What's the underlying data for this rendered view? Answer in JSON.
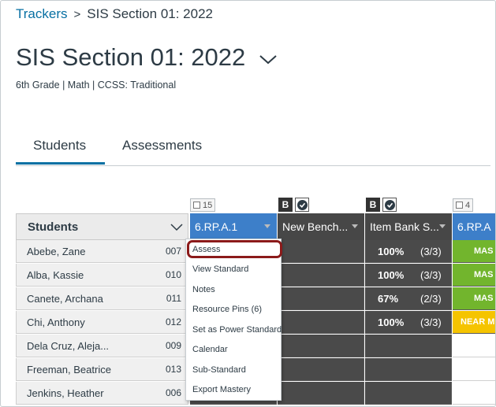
{
  "breadcrumb": {
    "link": "Trackers",
    "separator": ">",
    "current": "SIS Section 01: 2022"
  },
  "title": "SIS Section 01: 2022",
  "subtitle": "6th Grade | Math | CCSS: Traditional",
  "tabs": [
    {
      "label": "Students",
      "active": true
    },
    {
      "label": "Assessments",
      "active": false
    }
  ],
  "badges": {
    "col1": "15",
    "col2": "B",
    "col3": "B",
    "col4": "4"
  },
  "grid": {
    "students_header": "Students",
    "columns": [
      "6.RP.A.1",
      "New Bench...",
      "Item Bank S...",
      "6.RP.A"
    ],
    "rows": [
      {
        "name": "Abebe, Zane",
        "id": "007",
        "score": "",
        "fraction": "",
        "mastery": "MAS",
        "mastery_color": "green"
      },
      {
        "name": "Alba, Kassie",
        "id": "010",
        "score": "100%",
        "fraction": "(3/3)",
        "mastery": "MAS",
        "mastery_color": "green"
      },
      {
        "name": "Canete, Archana",
        "id": "011",
        "score": "67%",
        "fraction": "(2/3)",
        "mastery": "MAS",
        "mastery_color": "green"
      },
      {
        "name": "Chi, Anthony",
        "id": "012",
        "score": "100%",
        "fraction": "(3/3)",
        "mastery": "NEAR M",
        "mastery_color": "yellow"
      },
      {
        "name": "Dela Cruz, Aleja...",
        "id": "009",
        "score": "",
        "fraction": "",
        "mastery": "",
        "mastery_color": "empty"
      },
      {
        "name": "Freeman, Beatrice",
        "id": "013",
        "score": "",
        "fraction": "",
        "mastery": "",
        "mastery_color": "empty"
      },
      {
        "name": "Jenkins, Heather",
        "id": "006",
        "score": "",
        "fraction": "",
        "mastery": "",
        "mastery_color": "empty"
      }
    ],
    "first_row_score": {
      "score": "100%",
      "fraction": "(3/3)"
    }
  },
  "menu": {
    "items": [
      "Assess",
      "View Standard",
      "Notes",
      "Resource Pins (6)",
      "Set as Power Standard",
      "Calendar",
      "Sub-Standard",
      "Export Mastery"
    ],
    "highlighted": "Assess"
  },
  "colors": {
    "link": "#0770a3",
    "tab_underline": "#0770a3",
    "column_blue": "#3d7fc9",
    "column_dark": "#474747",
    "mastery_green": "#72b52d",
    "near_yellow": "#f5c400",
    "highlight_ring": "#8b1a1a"
  }
}
